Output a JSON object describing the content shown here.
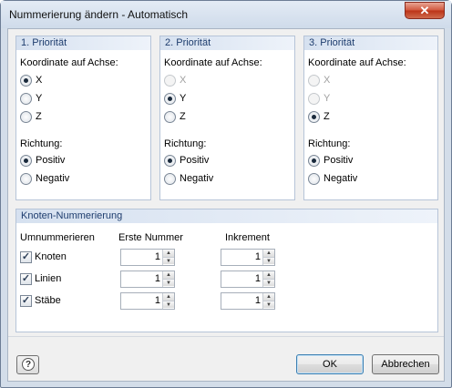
{
  "window": {
    "title": "Nummerierung ändern - Automatisch",
    "close_glyph": "✕"
  },
  "priority_groups": [
    {
      "title": "1. Priorität",
      "axis_label": "Koordinate auf Achse:",
      "axes": [
        {
          "label": "X",
          "selected": true,
          "enabled": true
        },
        {
          "label": "Y",
          "selected": false,
          "enabled": true
        },
        {
          "label": "Z",
          "selected": false,
          "enabled": true
        }
      ],
      "direction_label": "Richtung:",
      "directions": [
        {
          "label": "Positiv",
          "selected": true
        },
        {
          "label": "Negativ",
          "selected": false
        }
      ]
    },
    {
      "title": "2. Priorität",
      "axis_label": "Koordinate auf Achse:",
      "axes": [
        {
          "label": "X",
          "selected": false,
          "enabled": false
        },
        {
          "label": "Y",
          "selected": true,
          "enabled": true
        },
        {
          "label": "Z",
          "selected": false,
          "enabled": true
        }
      ],
      "direction_label": "Richtung:",
      "directions": [
        {
          "label": "Positiv",
          "selected": true
        },
        {
          "label": "Negativ",
          "selected": false
        }
      ]
    },
    {
      "title": "3. Priorität",
      "axis_label": "Koordinate auf Achse:",
      "axes": [
        {
          "label": "X",
          "selected": false,
          "enabled": false
        },
        {
          "label": "Y",
          "selected": false,
          "enabled": false
        },
        {
          "label": "Z",
          "selected": true,
          "enabled": true
        }
      ],
      "direction_label": "Richtung:",
      "directions": [
        {
          "label": "Positiv",
          "selected": true
        },
        {
          "label": "Negativ",
          "selected": false
        }
      ]
    }
  ],
  "numbering": {
    "title": "Knoten-Nummerierung",
    "col_renumber": "Umnummerieren",
    "col_first": "Erste Nummer",
    "col_increment": "Inkrement",
    "rows": [
      {
        "label": "Knoten",
        "checked": true,
        "first": "1",
        "increment": "1"
      },
      {
        "label": "Linien",
        "checked": true,
        "first": "1",
        "increment": "1"
      },
      {
        "label": "Stäbe",
        "checked": true,
        "first": "1",
        "increment": "1"
      }
    ]
  },
  "buttons": {
    "ok": "OK",
    "cancel": "Abbrechen",
    "help_glyph": "?"
  },
  "check_glyph": "✓",
  "spin_up_glyph": "▲",
  "spin_down_glyph": "▼",
  "colors": {
    "accent": "#1e3d6e",
    "close": "#c7492d"
  }
}
